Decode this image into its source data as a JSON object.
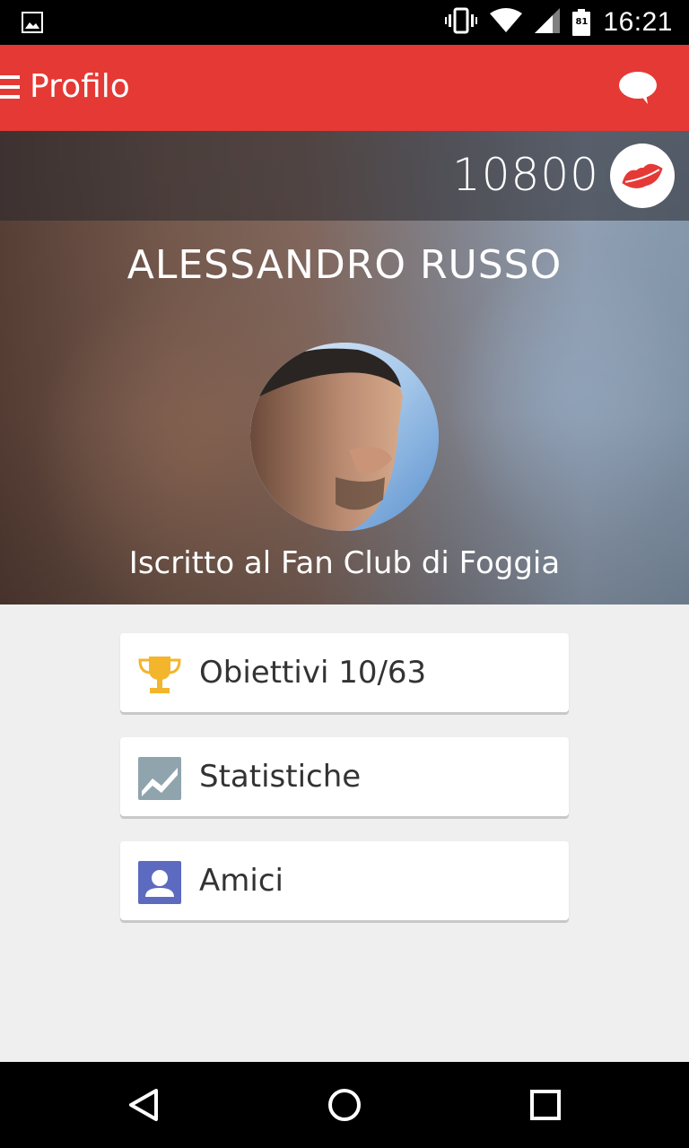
{
  "status_bar": {
    "time": "16:21",
    "battery": "81",
    "icons": [
      "image-icon",
      "vibrate-icon",
      "wifi-icon",
      "signal-icon",
      "battery-icon"
    ]
  },
  "app_bar": {
    "title": "Profilo",
    "menu_icon": "menu-icon",
    "chat_icon": "chat-icon",
    "color": "#e53935"
  },
  "profile": {
    "points": "10800",
    "points_icon": "lips-icon",
    "name": "ALESSANDRO RUSSO",
    "club": "Iscritto al Fan Club di Foggia"
  },
  "menu": [
    {
      "label": "Obiettivi 10/63",
      "icon": "trophy-icon",
      "icon_color": "#f3b52c"
    },
    {
      "label": "Statistiche",
      "icon": "chart-icon",
      "icon_color": "#90a4ae"
    },
    {
      "label": "Amici",
      "icon": "person-icon",
      "icon_color": "#5c6bc0"
    }
  ],
  "nav_bar": {
    "buttons": [
      "back-icon",
      "home-icon",
      "recents-icon"
    ]
  }
}
